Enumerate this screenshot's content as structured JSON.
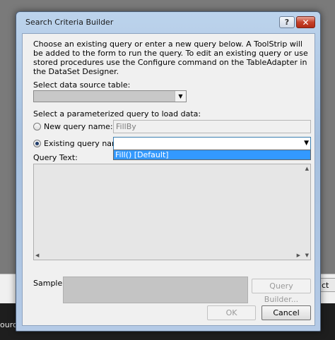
{
  "background": {
    "right_button_label": "ct",
    "bottom_tab_label": "ource"
  },
  "dialog": {
    "title": "Search Criteria Builder",
    "help_label": "?",
    "close_label": "✕",
    "description": "Choose an existing query or enter a new query below. A ToolStrip will be added to the form to run the query. To edit an existing query or use stored procedures use the Configure command on the TableAdapter in the DataSet Designer.",
    "data_source": {
      "label": "Select data source table:",
      "value": ""
    },
    "query_section_label": "Select a parameterized query to load data:",
    "new_query": {
      "label": "New query name:",
      "value": "FillBy",
      "selected": false
    },
    "existing_query": {
      "label": "Existing query name:",
      "value": "",
      "selected": true,
      "options": [
        "Fill() [Default]"
      ]
    },
    "query_text": {
      "label": "Query Text:",
      "value": ""
    },
    "sample": {
      "label": "Sample:"
    },
    "buttons": {
      "query_builder": "Query Builder...",
      "ok": "OK",
      "cancel": "Cancel"
    }
  },
  "colors": {
    "selection": "#3399ff",
    "focus_border": "#3c7fb1",
    "window_frame": "#a6c0de"
  }
}
